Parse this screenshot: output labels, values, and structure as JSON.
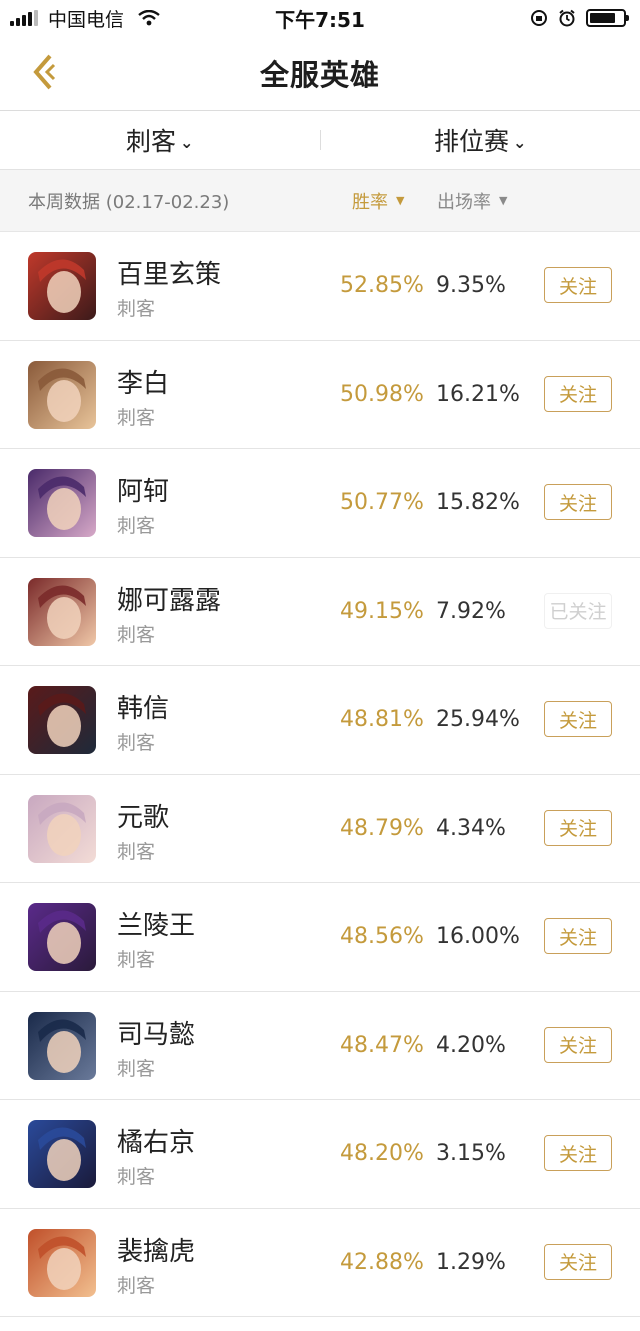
{
  "status_bar": {
    "carrier": "中国电信",
    "time": "下午7:51"
  },
  "nav": {
    "title": "全服英雄",
    "back_icon": "back-arrow-icon"
  },
  "filters": {
    "role_label": "刺客",
    "mode_label": "排位赛"
  },
  "subheader": {
    "week_label": "本周数据 (02.17-02.23)",
    "win_rate_label": "胜率",
    "pick_rate_label": "出场率"
  },
  "heroes": [
    {
      "name": "百里玄策",
      "role": "刺客",
      "win_rate": "52.85%",
      "pick_rate": "9.35%",
      "follow_label": "关注",
      "followed": false,
      "colors": [
        "#c0392b",
        "#3b1a1a"
      ]
    },
    {
      "name": "李白",
      "role": "刺客",
      "win_rate": "50.98%",
      "pick_rate": "16.21%",
      "follow_label": "关注",
      "followed": false,
      "colors": [
        "#8a5a3a",
        "#e8c49a"
      ]
    },
    {
      "name": "阿轲",
      "role": "刺客",
      "win_rate": "50.77%",
      "pick_rate": "15.82%",
      "follow_label": "关注",
      "followed": false,
      "colors": [
        "#4a2a6a",
        "#d7a9c8"
      ]
    },
    {
      "name": "娜可露露",
      "role": "刺客",
      "win_rate": "49.15%",
      "pick_rate": "7.92%",
      "follow_label": "已关注",
      "followed": true,
      "colors": [
        "#7a2a2a",
        "#f0c8a8"
      ]
    },
    {
      "name": "韩信",
      "role": "刺客",
      "win_rate": "48.81%",
      "pick_rate": "25.94%",
      "follow_label": "关注",
      "followed": false,
      "colors": [
        "#5a1a1a",
        "#1e2a3a"
      ]
    },
    {
      "name": "元歌",
      "role": "刺客",
      "win_rate": "48.79%",
      "pick_rate": "4.34%",
      "follow_label": "关注",
      "followed": false,
      "colors": [
        "#c8a8c0",
        "#f3dcd6"
      ]
    },
    {
      "name": "兰陵王",
      "role": "刺客",
      "win_rate": "48.56%",
      "pick_rate": "16.00%",
      "follow_label": "关注",
      "followed": false,
      "colors": [
        "#5a2a8a",
        "#2a1a3a"
      ]
    },
    {
      "name": "司马懿",
      "role": "刺客",
      "win_rate": "48.47%",
      "pick_rate": "4.20%",
      "follow_label": "关注",
      "followed": false,
      "colors": [
        "#1a2a4a",
        "#6a7a9a"
      ]
    },
    {
      "name": "橘右京",
      "role": "刺客",
      "win_rate": "48.20%",
      "pick_rate": "3.15%",
      "follow_label": "关注",
      "followed": false,
      "colors": [
        "#2a4a9a",
        "#1a1a3a"
      ]
    },
    {
      "name": "裴擒虎",
      "role": "刺客",
      "win_rate": "42.88%",
      "pick_rate": "1.29%",
      "follow_label": "关注",
      "followed": false,
      "colors": [
        "#c0502a",
        "#f2c090"
      ]
    }
  ],
  "colors": {
    "accent": "#c49a3c",
    "text": "#222222",
    "muted": "#999999"
  }
}
